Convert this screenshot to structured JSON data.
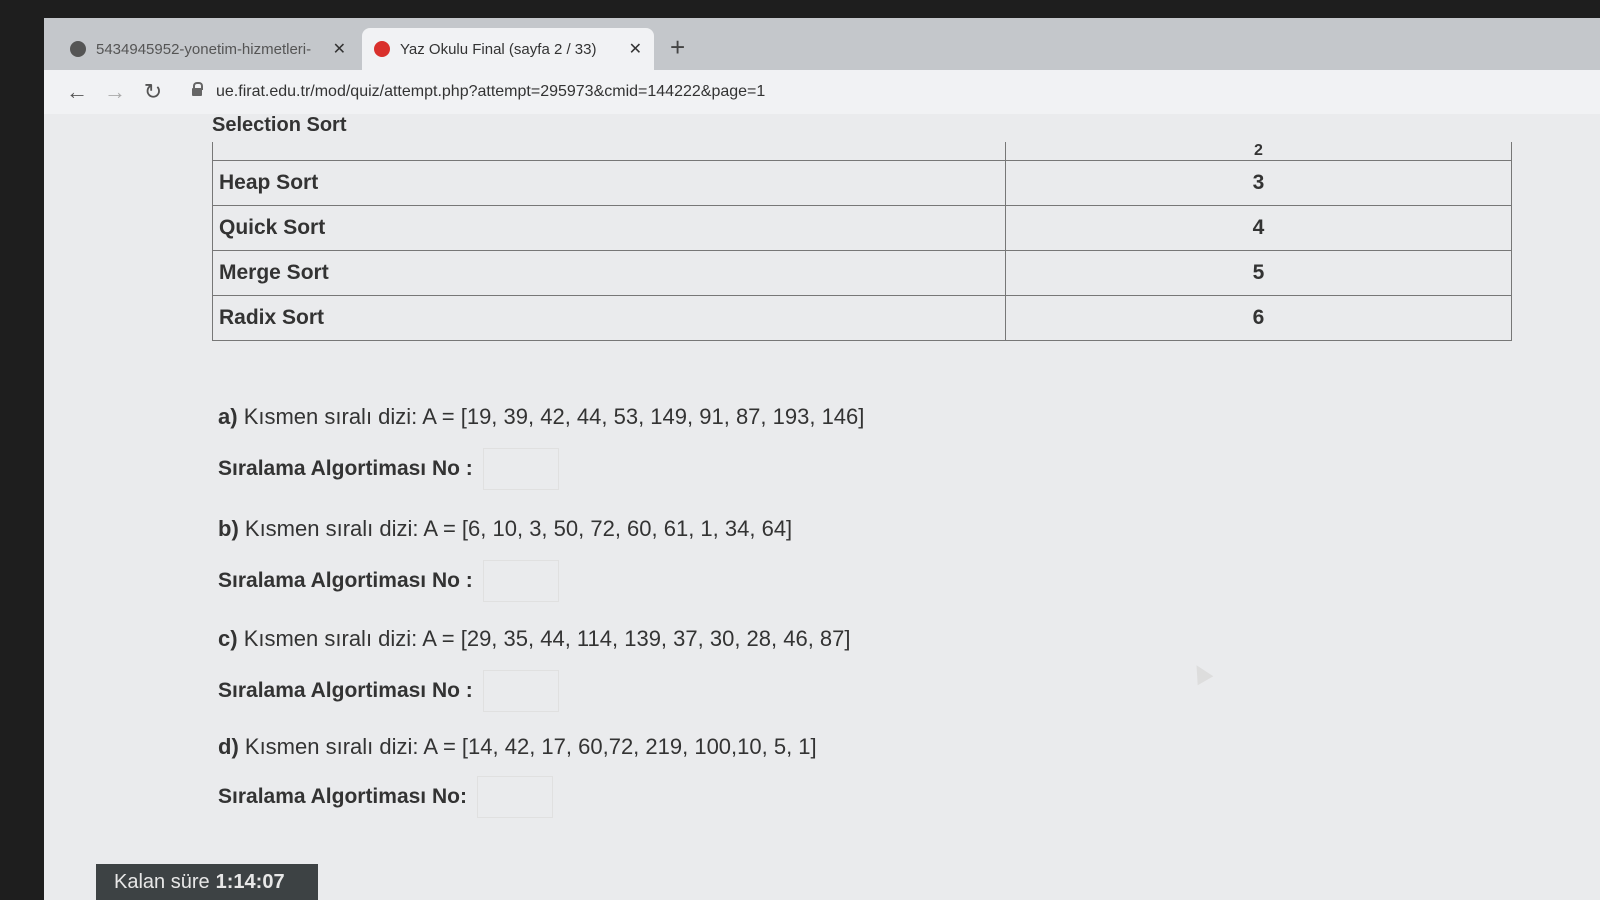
{
  "tabs": [
    {
      "title": "5434945952-yonetim-hizmetleri-",
      "active": false
    },
    {
      "title": "Yaz Okulu Final (sayfa 2 / 33)",
      "active": true
    }
  ],
  "toolbar": {
    "url": "ue.firat.edu.tr/mod/quiz/attempt.php?attempt=295973&cmid=144222&page=1"
  },
  "table": {
    "partial_header": {
      "name": "Selection Sort",
      "num": "2"
    },
    "rows": [
      {
        "name": "Heap Sort",
        "num": "3"
      },
      {
        "name": "Quick Sort",
        "num": "4"
      },
      {
        "name": "Merge Sort",
        "num": "5"
      },
      {
        "name": "Radix Sort",
        "num": "6"
      }
    ]
  },
  "questions": [
    {
      "label": "a)",
      "text": "Kısmen sıralı dizi: A = [19, 39, 42, 44, 53, 149, 91, 87, 193, 146]",
      "answer_label": "Sıralama Algortiması No :"
    },
    {
      "label": "b)",
      "text": "Kısmen sıralı dizi: A = [6, 10, 3, 50, 72, 60, 61, 1, 34, 64]",
      "answer_label": "Sıralama Algortiması No :"
    },
    {
      "label": "c)",
      "text": "Kısmen sıralı dizi: A = [29, 35, 44, 114, 139, 37, 30, 28, 46, 87]",
      "answer_label": "Sıralama Algortiması  No :"
    },
    {
      "label": "d)",
      "text": "Kısmen sıralı dizi: A = [14, 42, 17, 60,72, 219, 100,10, 5, 1]",
      "answer_label": "Sıralama Algortiması No:"
    }
  ],
  "timer": {
    "label": "Kalan süre",
    "value": "1:14:07"
  }
}
